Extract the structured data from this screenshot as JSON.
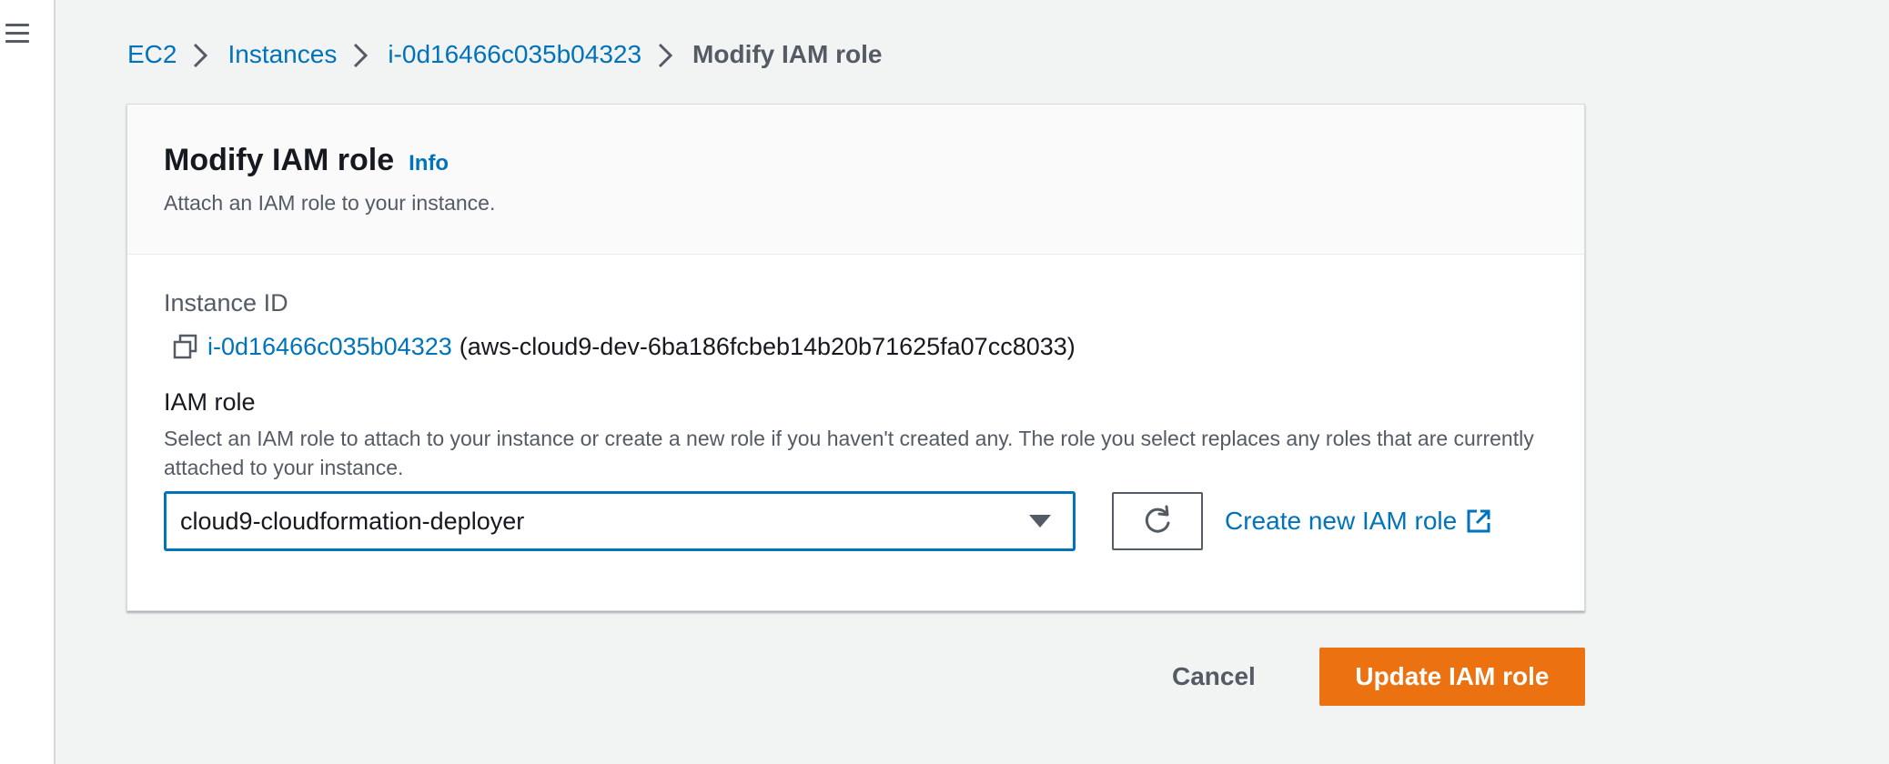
{
  "breadcrumb": {
    "items": [
      "EC2",
      "Instances",
      "i-0d16466c035b04323"
    ],
    "current": "Modify IAM role"
  },
  "panel": {
    "title": "Modify IAM role",
    "info_label": "Info",
    "description": "Attach an IAM role to your instance."
  },
  "instance": {
    "label": "Instance ID",
    "id": "i-0d16466c035b04323",
    "name": "(aws-cloud9-dev-6ba186fcbeb14b20b71625fa07cc8033)"
  },
  "iam_role": {
    "label": "IAM role",
    "description": "Select an IAM role to attach to your instance or create a new role if you haven't created any. The role you select replaces any roles that are currently attached to your instance.",
    "selected": "cloud9-cloudformation-deployer",
    "create_link_label": "Create new IAM role"
  },
  "actions": {
    "cancel_label": "Cancel",
    "submit_label": "Update IAM role"
  },
  "icons": {
    "menu": "hamburger-menu-icon",
    "copy": "copy-icon",
    "refresh": "refresh-icon",
    "external": "external-link-icon",
    "dropdown": "caret-down-icon"
  },
  "colors": {
    "link": "#0073bb",
    "primary_button": "#ec7211",
    "focus_border": "#0073bb",
    "background": "#f2f3f3"
  }
}
